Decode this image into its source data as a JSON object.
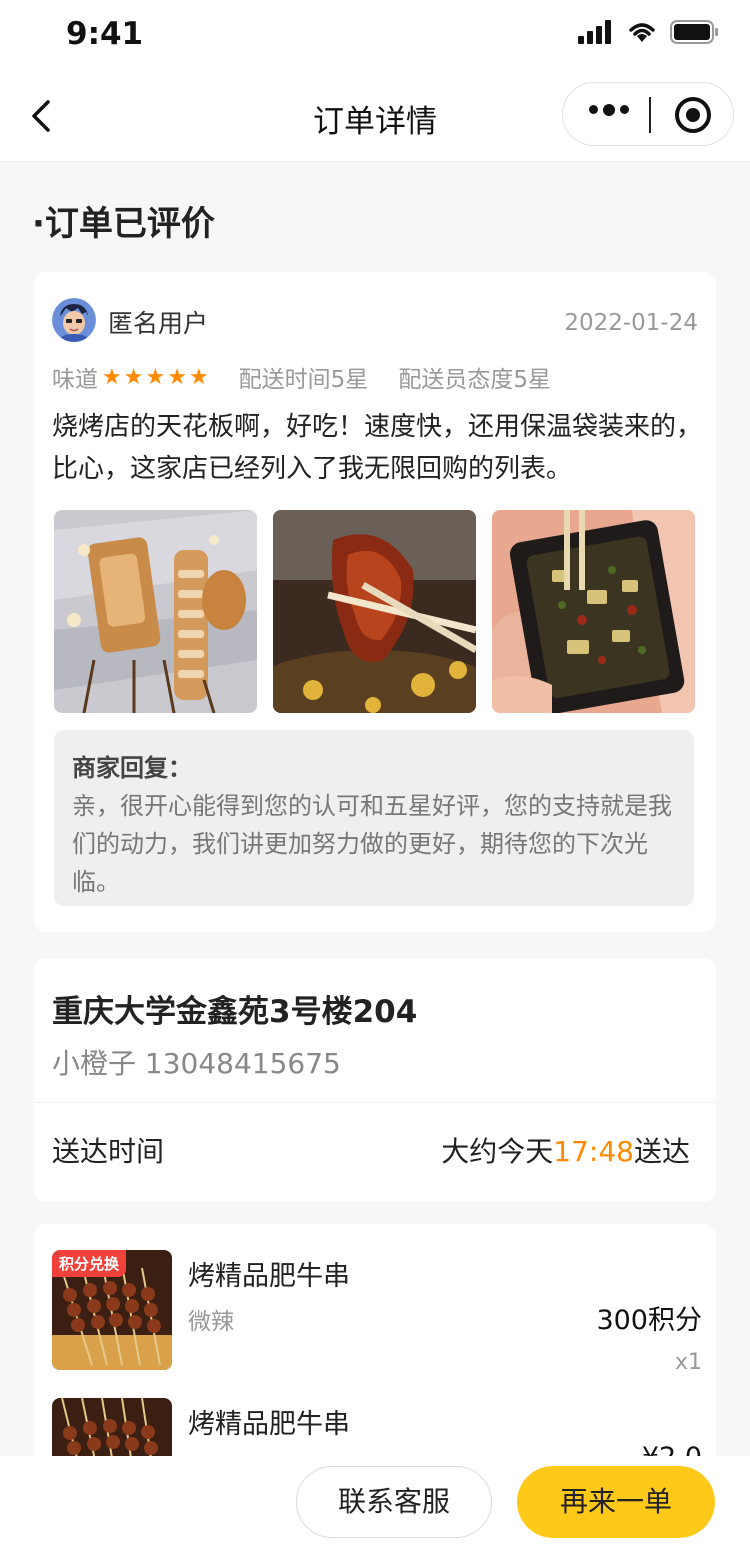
{
  "status_bar": {
    "time": "9:41"
  },
  "nav": {
    "title": "订单详情"
  },
  "section": {
    "heading": "·订单已评价"
  },
  "review": {
    "reviewer": "匿名用户",
    "date": "2022-01-24",
    "taste_label": "味道",
    "taste_stars": 5,
    "delivery_time_rating": "配送时间5星",
    "courier_rating": "配送员态度5星",
    "text": "烧烤店的天花板啊，好吃！速度快，还用保温袋装来的，比心，这家店已经列入了我无限回购的列表。",
    "reply_title": "商家回复：",
    "reply_text": "亲，很开心能得到您的认可和五星好评，您的支持就是我们的动力，我们讲更加努力做的更好，期待您的下次光临。"
  },
  "address": {
    "address": "重庆大学金鑫苑3号楼204",
    "contact": "小橙子 13048415675",
    "delivery_label": "送达时间",
    "delivery_prefix": "大约今天",
    "delivery_time": "17:48",
    "delivery_suffix": "送达"
  },
  "items": [
    {
      "badge": "积分兑换",
      "name": "烤精品肥牛串",
      "spec": "微辣",
      "price": "300积分",
      "qty": "x1"
    },
    {
      "name": "烤精品肥牛串",
      "price": "¥2.0"
    }
  ],
  "bottom": {
    "service_label": "联系客服",
    "reorder_label": "再来一单"
  },
  "colors": {
    "accent": "#ff8a00",
    "primary_button": "#ffc91a",
    "badge": "#f2413a"
  }
}
